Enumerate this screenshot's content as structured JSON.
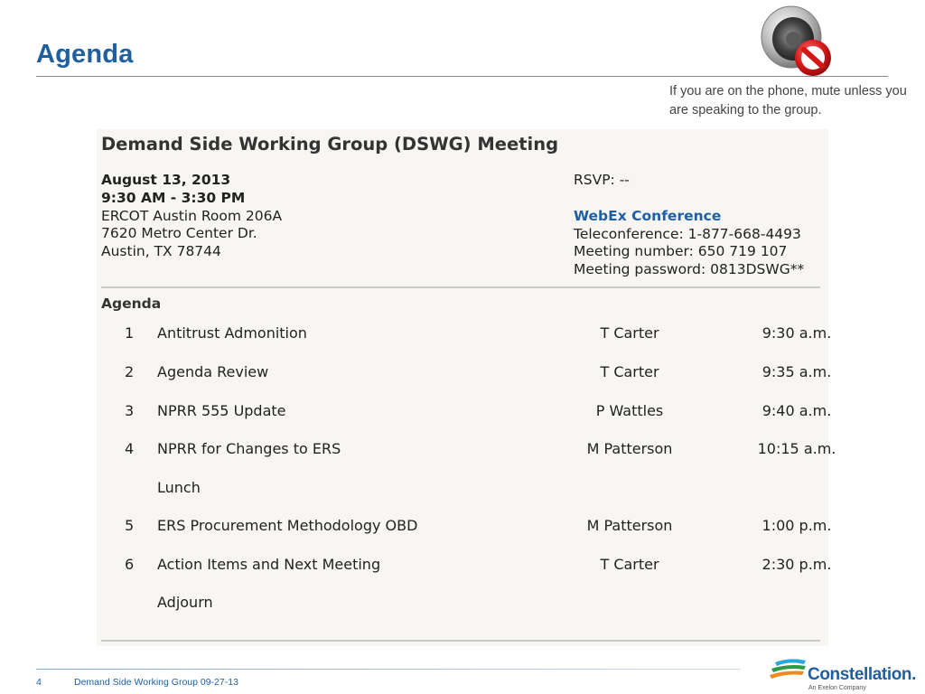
{
  "slide": {
    "title": "Agenda",
    "mute_note": "If you are on the phone, mute unless you are speaking to the group."
  },
  "document": {
    "heading": "Demand Side Working Group (DSWG) Meeting",
    "date": "August 13, 2013",
    "time": "9:30 AM - 3:30 PM",
    "location_lines": [
      "ERCOT Austin Room 206A",
      "7620 Metro Center Dr.",
      "Austin, TX 78744"
    ],
    "rsvp": "RSVP: --",
    "webex_title": "WebEx Conference",
    "teleconference": "Teleconference: 1-877-668-4493",
    "meeting_number": "Meeting number: 650 719 107",
    "meeting_password": "Meeting password: 0813DSWG**",
    "agenda_label": "Agenda",
    "agenda_items": [
      {
        "num": "1",
        "topic": "Antitrust Admonition",
        "presenter": "T Carter",
        "time": "9:30 a.m."
      },
      {
        "num": "2",
        "topic": "Agenda Review",
        "presenter": "T Carter",
        "time": "9:35 a.m."
      },
      {
        "num": "3",
        "topic": "NPRR 555 Update",
        "presenter": "P Wattles",
        "time": "9:40 a.m."
      },
      {
        "num": "4",
        "topic": "NPRR for Changes to ERS",
        "presenter": "M Patterson",
        "time": "10:15 a.m."
      },
      {
        "num": "",
        "topic": "Lunch",
        "presenter": "",
        "time": ""
      },
      {
        "num": "5",
        "topic": "ERS Procurement Methodology OBD",
        "presenter": "M Patterson",
        "time": "1:00 p.m."
      },
      {
        "num": "6",
        "topic": "Action Items and Next Meeting",
        "presenter": "T Carter",
        "time": "2:30 p.m."
      },
      {
        "num": "",
        "topic": "Adjourn",
        "presenter": "",
        "time": ""
      }
    ]
  },
  "footer": {
    "page_number": "4",
    "text": "Demand Side Working Group 09-27-13",
    "logo_name": "Constellation.",
    "logo_sub": "An Exelon Company"
  },
  "icons": {
    "speaker": "speaker-muted-icon",
    "logo": "constellation-logo-icon"
  },
  "colors": {
    "title": "#1f5f9f",
    "webex": "#1e5fa8",
    "panel": "#f7f6f3"
  }
}
